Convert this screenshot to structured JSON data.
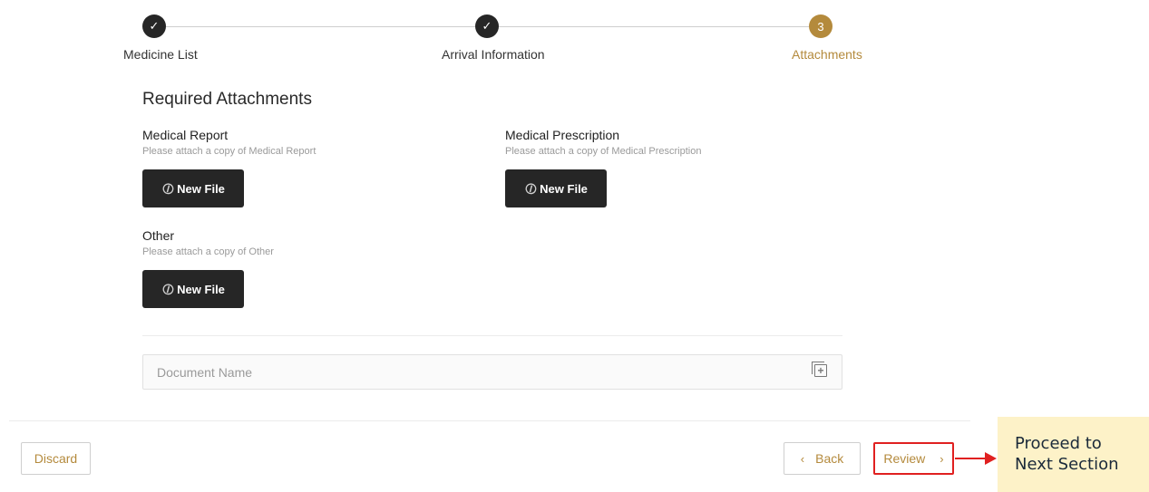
{
  "stepper": {
    "steps": [
      {
        "label": "Medicine List",
        "indicator": "✓",
        "state": "done"
      },
      {
        "label": "Arrival Information",
        "indicator": "✓",
        "state": "done"
      },
      {
        "label": "Attachments",
        "indicator": "3",
        "state": "active"
      }
    ]
  },
  "form": {
    "section_title": "Required Attachments",
    "attachments": [
      {
        "title": "Medical Report",
        "hint": "Please attach a copy of Medical Report",
        "button_label": "New File"
      },
      {
        "title": "Medical Prescription",
        "hint": "Please attach a copy of Medical Prescription",
        "button_label": "New File"
      },
      {
        "title": "Other",
        "hint": "Please attach a copy of Other",
        "button_label": "New File"
      }
    ],
    "document_name": {
      "placeholder": "Document Name",
      "value": ""
    }
  },
  "footer": {
    "discard_label": "Discard",
    "back_label": "Back",
    "review_label": "Review"
  },
  "annotation": {
    "text_line1": "Proceed to",
    "text_line2": "Next Section"
  },
  "colors": {
    "accent": "#b48a3c",
    "dark": "#262626",
    "highlight": "#e02020",
    "callout_bg": "#fdf2c8"
  },
  "icons": {
    "step_done": "check-icon",
    "file_button": "paperclip-icon",
    "doc_add": "add-document-icon",
    "back": "chevron-left-icon",
    "review": "chevron-right-icon"
  }
}
